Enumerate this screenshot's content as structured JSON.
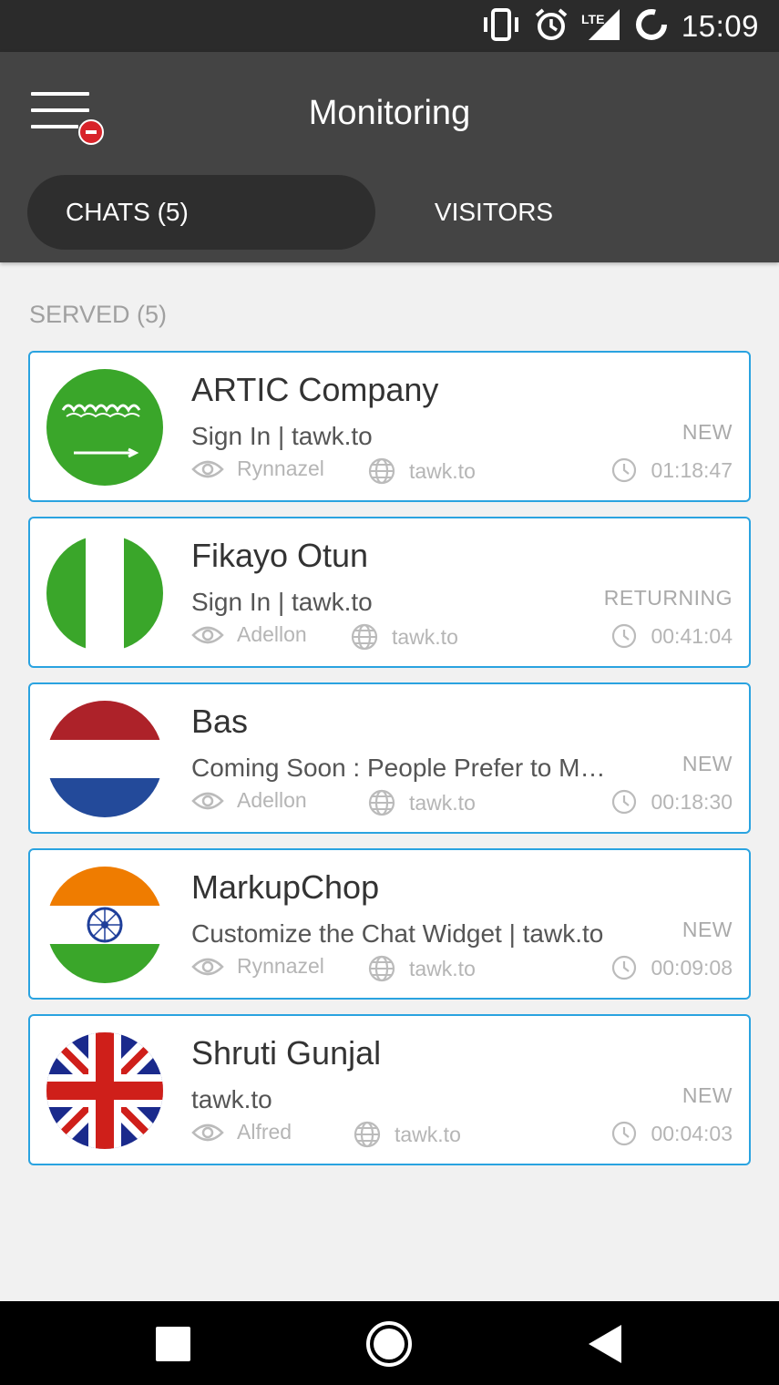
{
  "status_bar": {
    "time": "15:09",
    "icons": [
      "vibrate-icon",
      "alarm-icon",
      "lte-signal-icon",
      "battery-icon"
    ]
  },
  "header": {
    "title": "Monitoring",
    "menu_icon": "menu-icon"
  },
  "tabs": [
    {
      "label": "CHATS (5)",
      "active": true
    },
    {
      "label": "VISITORS",
      "active": false
    }
  ],
  "section": {
    "label": "SERVED (5)"
  },
  "chats": [
    {
      "name": "ARTIC Company",
      "page": "Sign In | tawk.to",
      "type": "NEW",
      "agent": "Rynnazel",
      "site": "tawk.to",
      "duration": "01:18:47",
      "flag": "saudi-arabia-flag"
    },
    {
      "name": "Fikayo Otun",
      "page": "Sign In | tawk.to",
      "type": "RETURNING",
      "agent": "Adellon",
      "site": "tawk.to",
      "duration": "00:41:04",
      "flag": "nigeria-flag"
    },
    {
      "name": "Bas",
      "page": "Coming Soon : People Prefer to Me...",
      "type": "NEW",
      "agent": "Adellon",
      "site": "tawk.to",
      "duration": "00:18:30",
      "flag": "netherlands-flag"
    },
    {
      "name": "MarkupChop",
      "page": "Customize the Chat Widget | tawk.to",
      "type": "NEW",
      "agent": "Rynnazel",
      "site": "tawk.to",
      "duration": "00:09:08",
      "flag": "india-flag"
    },
    {
      "name": "Shruti Gunjal",
      "page": "tawk.to",
      "type": "NEW",
      "agent": "Alfred",
      "site": "tawk.to",
      "duration": "00:04:03",
      "flag": "united-kingdom-flag"
    }
  ],
  "colors": {
    "accent_border": "#2aa3e0",
    "app_bar": "#444444",
    "badge": "#d8232a"
  },
  "nav_bar": {
    "buttons": [
      "recents-square-icon",
      "home-circle-icon",
      "back-triangle-icon"
    ]
  }
}
